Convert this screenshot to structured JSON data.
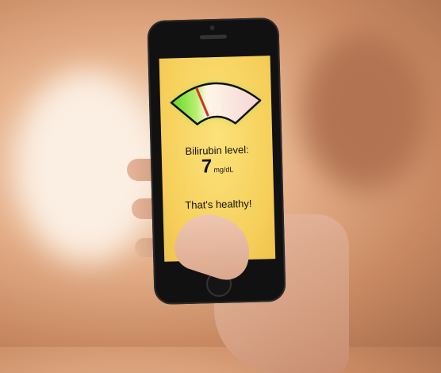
{
  "screen": {
    "gauge": {
      "level_fraction": 0.22,
      "zone_colors": [
        "#6fdc2a",
        "#fdf6e6",
        "#f7d6d6"
      ],
      "needle_color": "#d9301e"
    },
    "label": "Bilirubin level:",
    "value": "7",
    "unit": "mg/dL",
    "message": "That's healthy!"
  }
}
